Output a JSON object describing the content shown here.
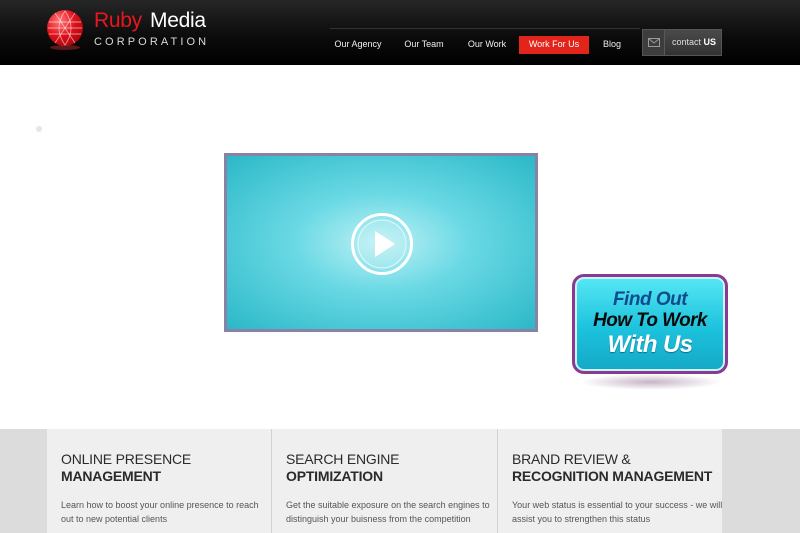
{
  "brand": {
    "name_part1": "Ruby",
    "name_part2": "Media",
    "subtitle": "CORPORATION"
  },
  "nav": {
    "items": [
      {
        "label": "Our Agency",
        "active": false
      },
      {
        "label": "Our Team",
        "active": false
      },
      {
        "label": "Our Work",
        "active": false
      },
      {
        "label": "Work For Us",
        "active": true
      },
      {
        "label": "Blog",
        "active": false
      }
    ],
    "contact_prefix": "contact",
    "contact_bold": "US",
    "contact_icon": "envelope-icon"
  },
  "hero": {
    "video_icon": "play-icon",
    "cta_line1": "Find Out",
    "cta_line2": "How To Work",
    "cta_line3": "With Us"
  },
  "services": [
    {
      "title_line1": "ONLINE PRESENCE",
      "title_line2": "MANAGEMENT",
      "description": "Learn how to boost your online presence to reach out to new potential clients"
    },
    {
      "title_line1": "SEARCH ENGINE",
      "title_line2": "OPTIMIZATION",
      "description": "Get the suitable exposure on the search engines to distinguish your buisness from the competition"
    },
    {
      "title_line1": "BRAND REVIEW &",
      "title_line2": "RECOGNITION MANAGEMENT",
      "description": "Your web status is essential to your success - we will assist you to strengthen this status"
    }
  ],
  "colors": {
    "brand_red": "#e8161f",
    "active_nav": "#e3241b",
    "video_teal": "#2bb8c8",
    "cta_border": "#8b3a8f"
  }
}
